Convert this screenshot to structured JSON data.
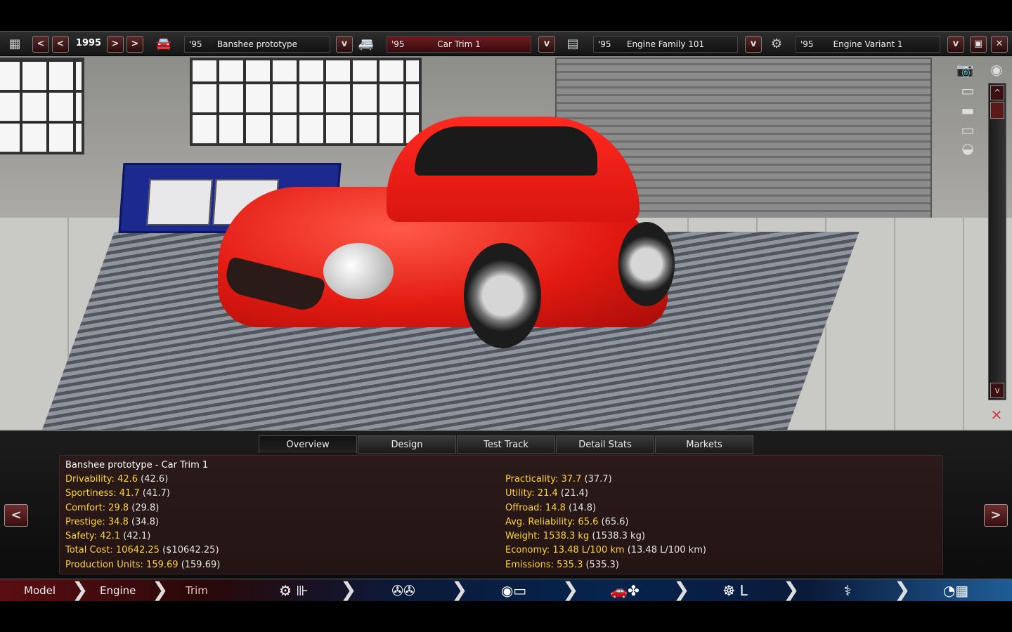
{
  "toolbar": {
    "year": "1995",
    "nav_prev2": "<",
    "nav_prev": "<",
    "nav_next": ">",
    "nav_next2": ">",
    "model": {
      "year": "'95",
      "name": "Banshee prototype"
    },
    "trim": {
      "year": "'95",
      "name": "Car Trim 1"
    },
    "engine_family": {
      "year": "'95",
      "name": "Engine Family 101"
    },
    "engine_variant": {
      "year": "'95",
      "name": "Engine Variant 1"
    },
    "dropdown_glyph": "v",
    "close_glyph": "✕"
  },
  "scrollbar": {
    "up": "^",
    "down": "v"
  },
  "tabs": [
    "Overview",
    "Design",
    "Test Track",
    "Detail Stats",
    "Markets"
  ],
  "active_tab": "Overview",
  "stats": {
    "title": "Banshee prototype - Car Trim 1",
    "left": [
      {
        "label": "Drivability: 42.6",
        "raw": "(42.6)"
      },
      {
        "label": "Sportiness: 41.7",
        "raw": "(41.7)"
      },
      {
        "label": "Comfort: 29.8",
        "raw": "(29.8)"
      },
      {
        "label": "Prestige: 34.8",
        "raw": "(34.8)"
      },
      {
        "label": "Safety: 42.1",
        "raw": "(42.1)"
      },
      {
        "label": "Total Cost: 10642.25",
        "raw": "($10642.25)"
      },
      {
        "label": "Production Units: 159.69",
        "raw": "(159.69)"
      }
    ],
    "right": [
      {
        "label": "Practicality: 37.7",
        "raw": "(37.7)"
      },
      {
        "label": "Utility: 21.4",
        "raw": "(21.4)"
      },
      {
        "label": "Offroad: 14.8",
        "raw": "(14.8)"
      },
      {
        "label": "Avg. Reliability: 65.6",
        "raw": "(65.6)"
      },
      {
        "label": "Weight: 1538.3 kg",
        "raw": "(1538.3 kg)"
      },
      {
        "label": "Economy: 13.48 L/100 km",
        "raw": "(13.48 L/100 km)"
      },
      {
        "label": "Emissions: 535.3",
        "raw": "(535.3)"
      }
    ]
  },
  "panel_nav": {
    "prev": "<",
    "next": ">"
  },
  "bottom_nav": {
    "tabs": [
      "Model",
      "Engine",
      "Trim"
    ],
    "active": "Trim",
    "chevron": "❯"
  },
  "colors": {
    "stat_label": "#ffd43a",
    "car": "#e21a12",
    "bench": "#1c2a8f"
  }
}
